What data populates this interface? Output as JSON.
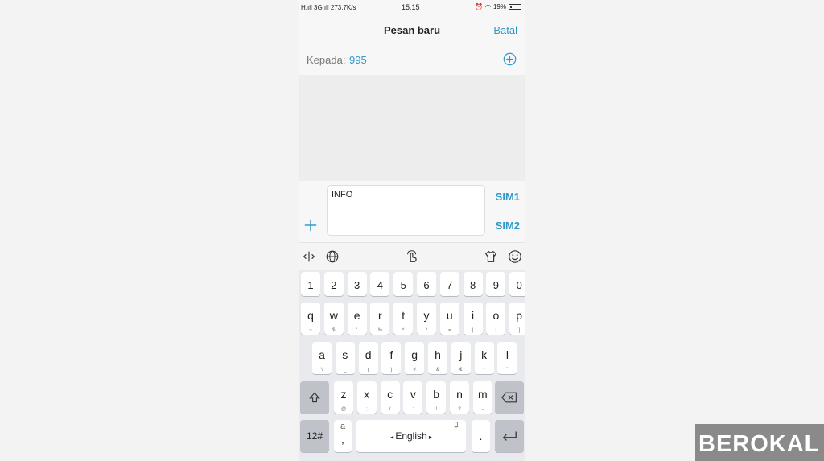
{
  "status_bar": {
    "left": "H.ıll 3G.ıll 273,7K/s",
    "time": "15:15",
    "battery": "19%",
    "battery_level": 0.19
  },
  "header": {
    "title": "Pesan baru",
    "cancel_label": "Batal"
  },
  "recipient": {
    "label": "Kepada:",
    "value": "995",
    "add_icon": "plus-circle-icon"
  },
  "compose": {
    "message_text": "INFO",
    "sim1_label": "SIM1",
    "sim2_label": "SIM2",
    "attach_icon": "plus-icon"
  },
  "keyboard_toolbar": {
    "icons": [
      "cursor-move-icon",
      "globe-icon",
      "swipe-gesture-icon",
      "theme-shirt-icon",
      "emoji-icon"
    ]
  },
  "keyboard": {
    "number_row": [
      "1",
      "2",
      "3",
      "4",
      "5",
      "6",
      "7",
      "8",
      "9",
      "0"
    ],
    "row1": [
      {
        "k": "q",
        "s": "~"
      },
      {
        "k": "w",
        "s": "$"
      },
      {
        "k": "e",
        "s": "'"
      },
      {
        "k": "r",
        "s": "%"
      },
      {
        "k": "t",
        "s": "^"
      },
      {
        "k": "y",
        "s": "*"
      },
      {
        "k": "u",
        "s": "="
      },
      {
        "k": "i",
        "s": "|"
      },
      {
        "k": "o",
        "s": "["
      },
      {
        "k": "p",
        "s": "]"
      }
    ],
    "row2": [
      {
        "k": "a",
        "s": "\\"
      },
      {
        "k": "s",
        "s": "_"
      },
      {
        "k": "d",
        "s": "("
      },
      {
        "k": "f",
        "s": ")"
      },
      {
        "k": "g",
        "s": "#"
      },
      {
        "k": "h",
        "s": "&"
      },
      {
        "k": "j",
        "s": "€"
      },
      {
        "k": "k",
        "s": "*"
      },
      {
        "k": "l",
        "s": "\""
      }
    ],
    "row3": [
      {
        "k": "z",
        "s": "@"
      },
      {
        "k": "x",
        "s": ";"
      },
      {
        "k": "c",
        "s": "/"
      },
      {
        "k": "v",
        "s": ":"
      },
      {
        "k": "b",
        "s": "!"
      },
      {
        "k": "n",
        "s": "?"
      },
      {
        "k": "m",
        "s": "-"
      }
    ],
    "symbols_label": "12#",
    "punct_top": "a",
    "punct_bottom": ",",
    "space_label": "English",
    "period_label": "."
  },
  "watermark": {
    "text": "BEROKAL"
  },
  "colors": {
    "accent": "#2e98c9",
    "keyboard_bg": "#e8eaed",
    "key_dark": "#bfc3c9"
  }
}
